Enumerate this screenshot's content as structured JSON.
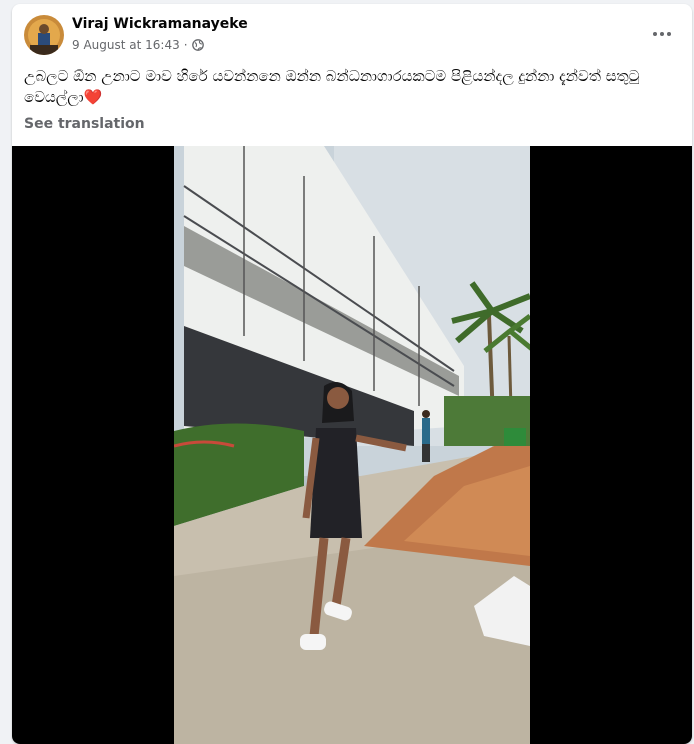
{
  "post": {
    "author_name": "Viraj Wickramanayeke",
    "date": "9 August at 16:43",
    "separator": "·",
    "privacy_icon": "globe-icon",
    "caption_text": "උබලට ඕන උනාට මාව හිරේ යවන්නනෙ ඔන්න බන්ධනාගාරයකටම පිළියන්දල දුන්නා දැන්වත් සතුටු වෙයල්ලා",
    "caption_emoji": "❤️",
    "see_translation": "See translation",
    "more_icon": "more-options-icon"
  },
  "colors": {
    "page_bg": "#f0f2f5",
    "card_bg": "#ffffff",
    "secondary_text": "#65676b",
    "primary_text": "#050505",
    "heart": "#e41e3f"
  },
  "video": {
    "background": "#000000",
    "subject": "woman-in-black-dress"
  }
}
